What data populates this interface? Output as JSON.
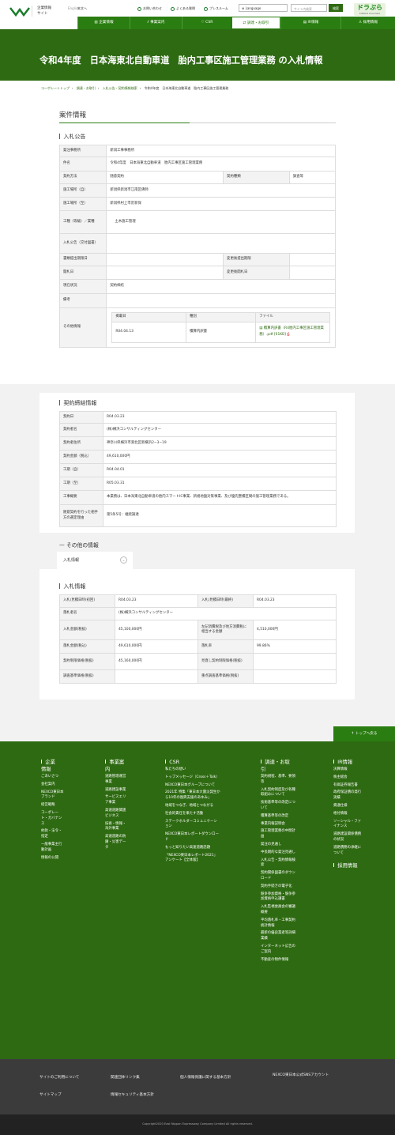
{
  "header": {
    "corporate": [
      "企業情報",
      "サイト"
    ],
    "english": "English",
    "home": "本文へ",
    "links": [
      "お問い合わせ",
      "よくある質問",
      "プレスルーム"
    ],
    "language": "Language",
    "search_placeholder": "サイト内検索",
    "search_btn": "検索",
    "dora": "ドラぷら",
    "dora_sub": "E-NEXCO Drive Plaza",
    "logo": "NEXCO 東日本"
  },
  "nav": [
    "企業情報",
    "事業案内",
    "CSR",
    "調達・お取引",
    "IR情報",
    "採用情報"
  ],
  "page_title": "令和4年度　日本海東北自動車道　胎内工事区施工管理業務 の入札情報",
  "breadcrumb": [
    "コーポレートトップ",
    "調達・お取引",
    "入札公告・契約情報検索",
    "令和4年度　日本海東北自動車道　胎内工事区施工管理業務"
  ],
  "section_title": "案件情報",
  "announce": {
    "title": "入札公告",
    "rows": [
      {
        "k": "発注事務所",
        "v": "新潟工事事務所"
      },
      {
        "k": "件名",
        "v": "令和4年度　日本海東北自動車道　胎内工事区施工管理業務"
      },
      {
        "k": "契約方法",
        "v": "随意契約",
        "k2": "契約種類",
        "v2": "調査等"
      },
      {
        "k": "施工場所（自）",
        "v": "新潟県新潟市江南区佛師"
      },
      {
        "k": "施工場所（至）",
        "v": "新潟県村上市荒新保"
      },
      {
        "k": "工種（等級）／業種",
        "v": "土木施工管理"
      },
      {
        "k": "入札公告（交付図書）",
        "v": ""
      },
      {
        "k": "書類提出期限日",
        "v": "",
        "k2": "変更後提出期限",
        "v2": ""
      },
      {
        "k": "開札日",
        "v": "",
        "k2": "変更後開札日",
        "v2": ""
      },
      {
        "k": "現在状況",
        "v": "契約締結"
      },
      {
        "k": "備考",
        "v": ""
      }
    ],
    "other_label": "その他情報",
    "files_head": [
      "掲載日",
      "種別",
      "ファイル"
    ],
    "files": [
      {
        "date": "R04.04.13",
        "type": "積算内訳書",
        "file": "積算内訳書（R4胎内工事区施工管理業務）.pdf [61KB]"
      }
    ]
  },
  "contract": {
    "title": "契約締結情報",
    "rows": [
      {
        "k": "契約日",
        "v": "R04.03.23"
      },
      {
        "k": "契約者名",
        "v": "(株)横浜コンサルティングセンター"
      },
      {
        "k": "契約者住所",
        "v": "神奈川県横浜市港北区新横浜2−3−19"
      },
      {
        "k": "契約金額（税込）",
        "v": "49,610,000円"
      },
      {
        "k": "工期（自）",
        "v": "R04.04.01"
      },
      {
        "k": "工期（至）",
        "v": "R05.03.31"
      },
      {
        "k": "工事概要",
        "v": "本業務は、日本海東北自動車道の胎内スマートIC事業、新规地盤対策事業、及び優先整備区間の施工管理業務である。"
      },
      {
        "k": "随意契約を行った相手方の選定理由",
        "v": "第5条5号：継続調達"
      }
    ]
  },
  "other_info": {
    "title": "その他の情報",
    "tab": "入札情報",
    "tab_icon": "⌄"
  },
  "bid": {
    "title": "入札情報",
    "rows": [
      {
        "k": "入札/見積日時(初回)",
        "v": "R04.03.23",
        "k2": "入札/見積日時(最終)",
        "v2": "R04.03.23"
      },
      {
        "k": "落札者名",
        "v": "(株)横浜コンサルティングセンター"
      },
      {
        "k": "入札金額(税抜)",
        "v": "45,100,000円",
        "k2": "左記消費税及び地方消費税に相当する金額",
        "v2": "4,510,000円"
      },
      {
        "k": "落札金額(税込)",
        "v": "49,610,000円",
        "k2": "落札率",
        "v2": "99.86%"
      },
      {
        "k": "契約制限価格(税抜)",
        "v": "45,160,000円",
        "k2": "見直し契約制限価格(税抜)",
        "v2": ""
      },
      {
        "k": "調査基準価格(税抜)",
        "v": "",
        "k2": "重点調査基準価格(税抜)",
        "v2": ""
      }
    ]
  },
  "totop": "トップへ戻る",
  "footer": {
    "cols": [
      {
        "head": [
          "企業",
          "情報"
        ],
        "links": [
          "ごあいさつ",
          "会社案内",
          "NEXCO東日本ブランド",
          "経営戦略",
          "コーポレート・ガバナンス",
          "約款・法令・指定",
          "一般事業主行動計画",
          "情報の公開"
        ]
      },
      {
        "head": [
          "事業案",
          "内"
        ],
        "links": [
          "道路管理運営事業",
          "道路建設事業",
          "サービスエリア事業",
          "高速道路関連ビジネス",
          "技術・情報・海外事業",
          "高速道路の防錆・災害データ"
        ]
      },
      {
        "head": [
          "CSR"
        ],
        "links": [
          "私たちの想い",
          "トップメッセージ（Cross＋Talk）",
          "NEXCO東日本グループについて",
          "2021年 特集「東日本大震災発生から10年の復興支援のあゆみ」",
          "地域をつなぎ、地域とつながる",
          "社会的責任を果たす活動",
          "ステークホルダーコミュニケーション",
          "NEXCO東日本レポートダウンロード",
          "もっと知りたい高速道路話題",
          "「NEXCO東日本レポート2021」アンケート【全体版】"
        ]
      },
      {
        "head": [
          "調達・お取",
          "引"
        ],
        "links": [
          "契約規程、基準、要領等",
          "入札契約制度及び各種取組みについて",
          "技術基準等の改定について",
          "積算基準等の改定",
          "事業内報説明会",
          "施工管理業務の中間計画",
          "発注の見通し",
          "中長期的な発注見通し",
          "入札公告・契約情報検索",
          "契約関係図書のダウンロード",
          "契約手続きの電子化",
          "競争参加資格・競争参加資格申込講書",
          "入札監視委員会の審議概要",
          "平均落札率・工事契約統計情報",
          "最新の優良業者等詳細業績",
          "インターネット広告のご案内",
          "不動産の物件情報"
        ]
      },
      {
        "head": [
          "IR情報"
        ],
        "links": [
          "決算情報",
          "株主総会",
          "有価証券報告書",
          "政府保証債の発行実績",
          "資通仕様",
          "格付情報",
          "ソーシャル・ファイナンス",
          "道路建設関係債務の状況",
          "道路債務の承継について"
        ]
      }
    ],
    "recruit": "採用情報",
    "bottom_links": [
      [
        "サイトのご利用について",
        "サイトマップ"
      ],
      [
        "関連団体リンク集",
        "情報セキュリティ基本方針"
      ],
      [
        "個人情報保護に関する基本方針"
      ],
      [
        "NEXCO東日本公式SNSアカウント"
      ]
    ],
    "copyright": "Copyright2020 East Nippon Expressway Company Limited All rights reserved."
  }
}
